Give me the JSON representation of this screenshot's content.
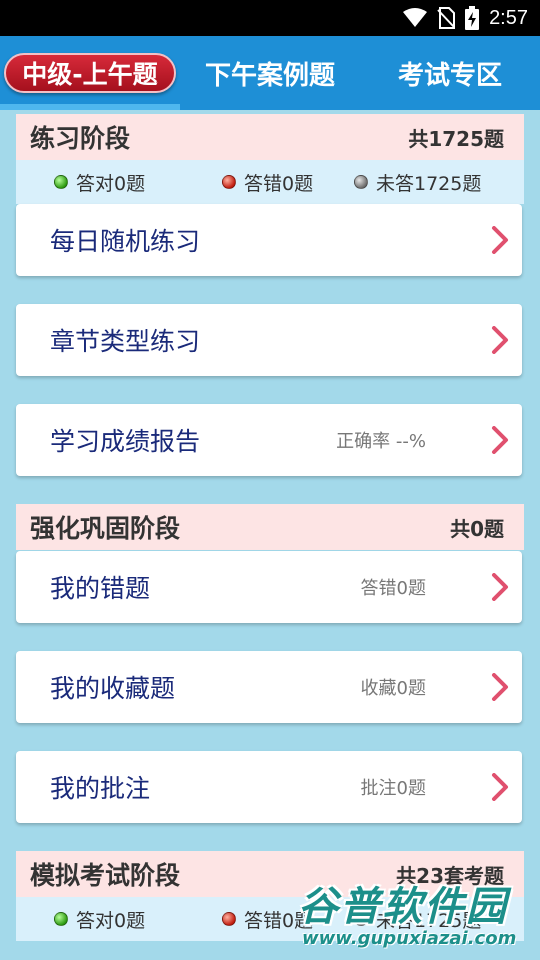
{
  "status_bar": {
    "time": "2:57",
    "icons": [
      "wifi-icon",
      "no-sim-icon",
      "battery-charging-icon"
    ]
  },
  "tabs": [
    {
      "label": "中级-上午题",
      "active": true
    },
    {
      "label": "下午案例题",
      "active": false
    },
    {
      "label": "考试专区",
      "active": false
    }
  ],
  "practice": {
    "title": "练习阶段",
    "count": "共1725题",
    "stats": {
      "correct": "答对0题",
      "wrong": "答错0题",
      "unanswered": "未答1725题"
    },
    "items": [
      {
        "label": "每日随机练习",
        "info": ""
      },
      {
        "label": "章节类型练习",
        "info": ""
      },
      {
        "label": "学习成绩报告",
        "info": "正确率 --%"
      }
    ]
  },
  "strengthen": {
    "title": "强化巩固阶段",
    "count": "共0题",
    "items": [
      {
        "label": "我的错题",
        "info": "答错0题"
      },
      {
        "label": "我的收藏题",
        "info": "收藏0题"
      },
      {
        "label": "我的批注",
        "info": "批注0题"
      }
    ]
  },
  "mock": {
    "title": "模拟考试阶段",
    "count": "共23套考题",
    "stats": {
      "correct": "答对0题",
      "wrong": "答错0题",
      "unanswered": "未答1725题"
    }
  },
  "watermark": {
    "logo": "谷普软件园",
    "url": "www.gupuxiazai.com"
  },
  "colors": {
    "tab_bar": "#1e8fd6",
    "active_tab": "#c41a2a",
    "background": "#a3d9ea",
    "section_header": "#fde4e4",
    "chevron": "#e0506e",
    "item_text": "#1a2a7a"
  }
}
